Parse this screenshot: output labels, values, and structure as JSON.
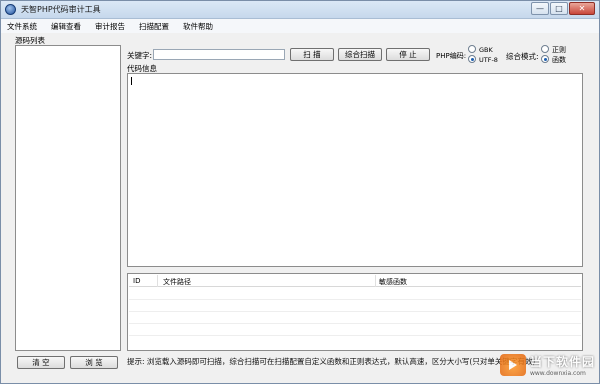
{
  "window": {
    "title": "天智PHP代码审计工具",
    "controls": {
      "minimize": "—",
      "maximize": "□",
      "close": "✕"
    }
  },
  "menu": {
    "items": [
      "文件系统",
      "编辑查看",
      "审计报告",
      "扫描配置",
      "软件帮助"
    ]
  },
  "source_panel": {
    "label": "源码列表",
    "clear_label": "清 空",
    "browse_label": "浏 览"
  },
  "toolbar": {
    "keyword_label": "关键字:",
    "keyword_value": "",
    "scan_label": "扫 描",
    "combo_scan_label": "综合扫描",
    "stop_label": "停 止",
    "encoding_label": "PHP编码:",
    "encoding_options": [
      "GBK",
      "UTF-8"
    ],
    "encoding_selected": "UTF-8",
    "mode_label": "综合模式:",
    "mode_options": [
      "正则",
      "函数"
    ],
    "mode_selected": "函数"
  },
  "code_area": {
    "label": "代码信息"
  },
  "results_table": {
    "columns": [
      "ID",
      "文件路径",
      "敏感函数"
    ]
  },
  "status": {
    "hint": "提示: 浏览载入源码即可扫描，综合扫描可在扫描配置自定义函数和正则表达式，默认高速，区分大小写(只对单关键字有效)"
  },
  "watermark": {
    "cn": "当下软件园",
    "en": "www.downxia.com"
  },
  "colors": {
    "window_bg": "#f0f0f0",
    "titlebar": "#c6d8ec",
    "radio_dot": "#1d5fb0"
  }
}
